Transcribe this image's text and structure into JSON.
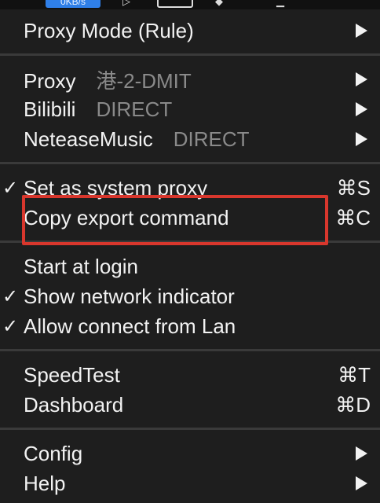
{
  "statusbar": {
    "speed": "0KB/s"
  },
  "menu": {
    "proxy_mode": {
      "label": "Proxy Mode (Rule)",
      "has_submenu": true
    },
    "proxy_groups": [
      {
        "name": "Proxy",
        "value": "港-2-DMIT",
        "has_submenu": true
      },
      {
        "name": "Bilibili",
        "value": "DIRECT",
        "has_submenu": true
      },
      {
        "name": "NeteaseMusic",
        "value": "DIRECT",
        "has_submenu": true
      }
    ],
    "system": [
      {
        "label": "Set as system proxy",
        "checked": true,
        "shortcut": "⌘S"
      },
      {
        "label": "Copy export command",
        "checked": false,
        "shortcut": "⌘C",
        "highlighted": true
      }
    ],
    "options": [
      {
        "label": "Start at login",
        "checked": false
      },
      {
        "label": "Show network indicator",
        "checked": true
      },
      {
        "label": "Allow connect from Lan",
        "checked": true
      }
    ],
    "tools": [
      {
        "label": "SpeedTest",
        "shortcut": "⌘T"
      },
      {
        "label": "Dashboard",
        "shortcut": "⌘D"
      }
    ],
    "footer": [
      {
        "label": "Config",
        "has_submenu": true
      },
      {
        "label": "Help",
        "has_submenu": true
      }
    ],
    "check_glyph": "✓"
  },
  "colors": {
    "menu_bg": "#1e1e1e",
    "text": "#f2f2f2",
    "secondary_text": "#8a8a8a",
    "separator": "#3a3a3a",
    "highlight_border": "#d8372d",
    "speed_pill": "#2f7fe8"
  }
}
